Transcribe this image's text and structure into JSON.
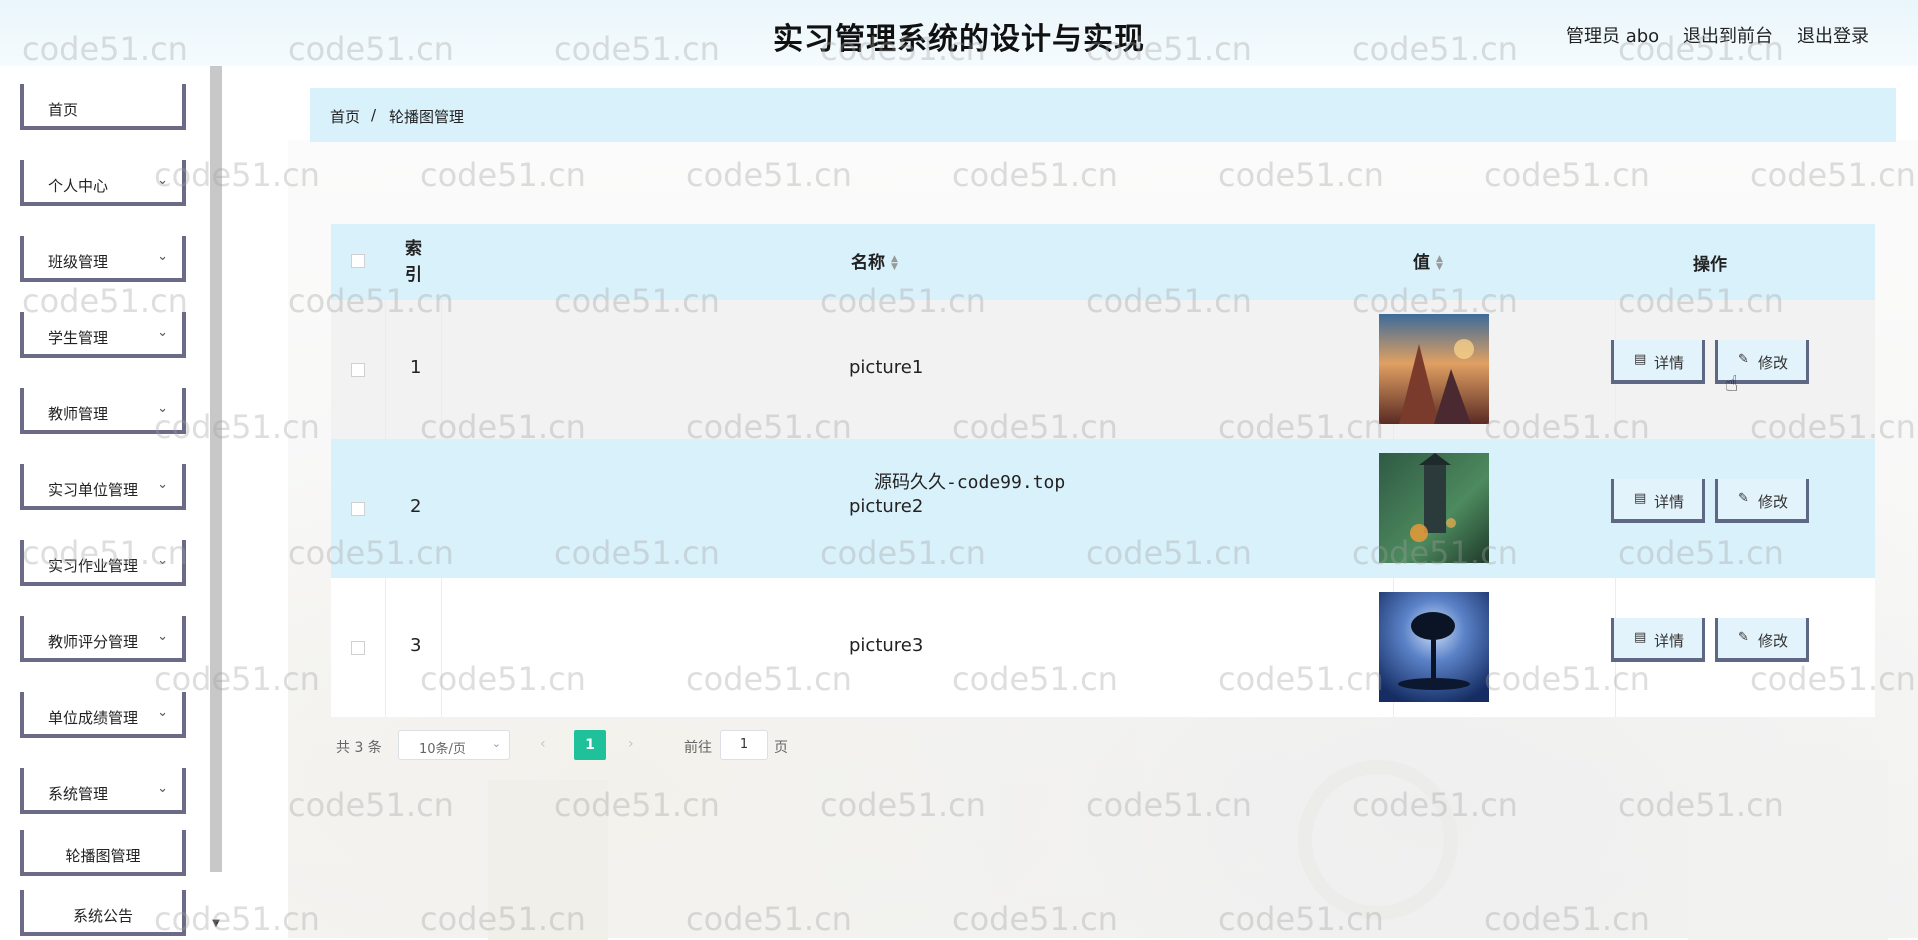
{
  "header": {
    "title": "实习管理系统的设计与实现",
    "user": "管理员 abo",
    "back_to_front": "退出到前台",
    "logout": "退出登录"
  },
  "sidebar": {
    "items": [
      {
        "label": "首页",
        "expandable": false
      },
      {
        "label": "个人中心",
        "expandable": true
      },
      {
        "label": "班级管理",
        "expandable": true
      },
      {
        "label": "学生管理",
        "expandable": true
      },
      {
        "label": "教师管理",
        "expandable": true
      },
      {
        "label": "实习单位管理",
        "expandable": true
      },
      {
        "label": "实习作业管理",
        "expandable": true
      },
      {
        "label": "教师评分管理",
        "expandable": true
      },
      {
        "label": "单位成绩管理",
        "expandable": true
      },
      {
        "label": "系统管理",
        "expandable": true
      },
      {
        "label": "轮播图管理",
        "expandable": false
      },
      {
        "label": "系统公告",
        "expandable": false
      }
    ]
  },
  "breadcrumb": {
    "home": "首页",
    "separator": "/",
    "current": "轮播图管理"
  },
  "table": {
    "columns": {
      "index": "索\n引",
      "name": "名称",
      "value": "值",
      "actions": "操作"
    },
    "rows": [
      {
        "index": "1",
        "name": "picture1",
        "image": "painting-icon"
      },
      {
        "index": "2",
        "name": "picture2",
        "image": "castle-icon"
      },
      {
        "index": "3",
        "name": "picture3",
        "image": "tree-icon"
      }
    ],
    "detail_label": "详情",
    "edit_label": "修改"
  },
  "pagination": {
    "total": "共 3 条",
    "page_size": "10条/页",
    "current_page": "1",
    "goto_label": "前往",
    "goto_value": "1",
    "page_suffix": "页"
  },
  "overlay": "源码久久-code99.top",
  "watermark": "code51.cn",
  "colors": {
    "accent": "#1fc19a",
    "header_bg": "#d9f1fb",
    "sidebar_border": "#6b6b88"
  }
}
